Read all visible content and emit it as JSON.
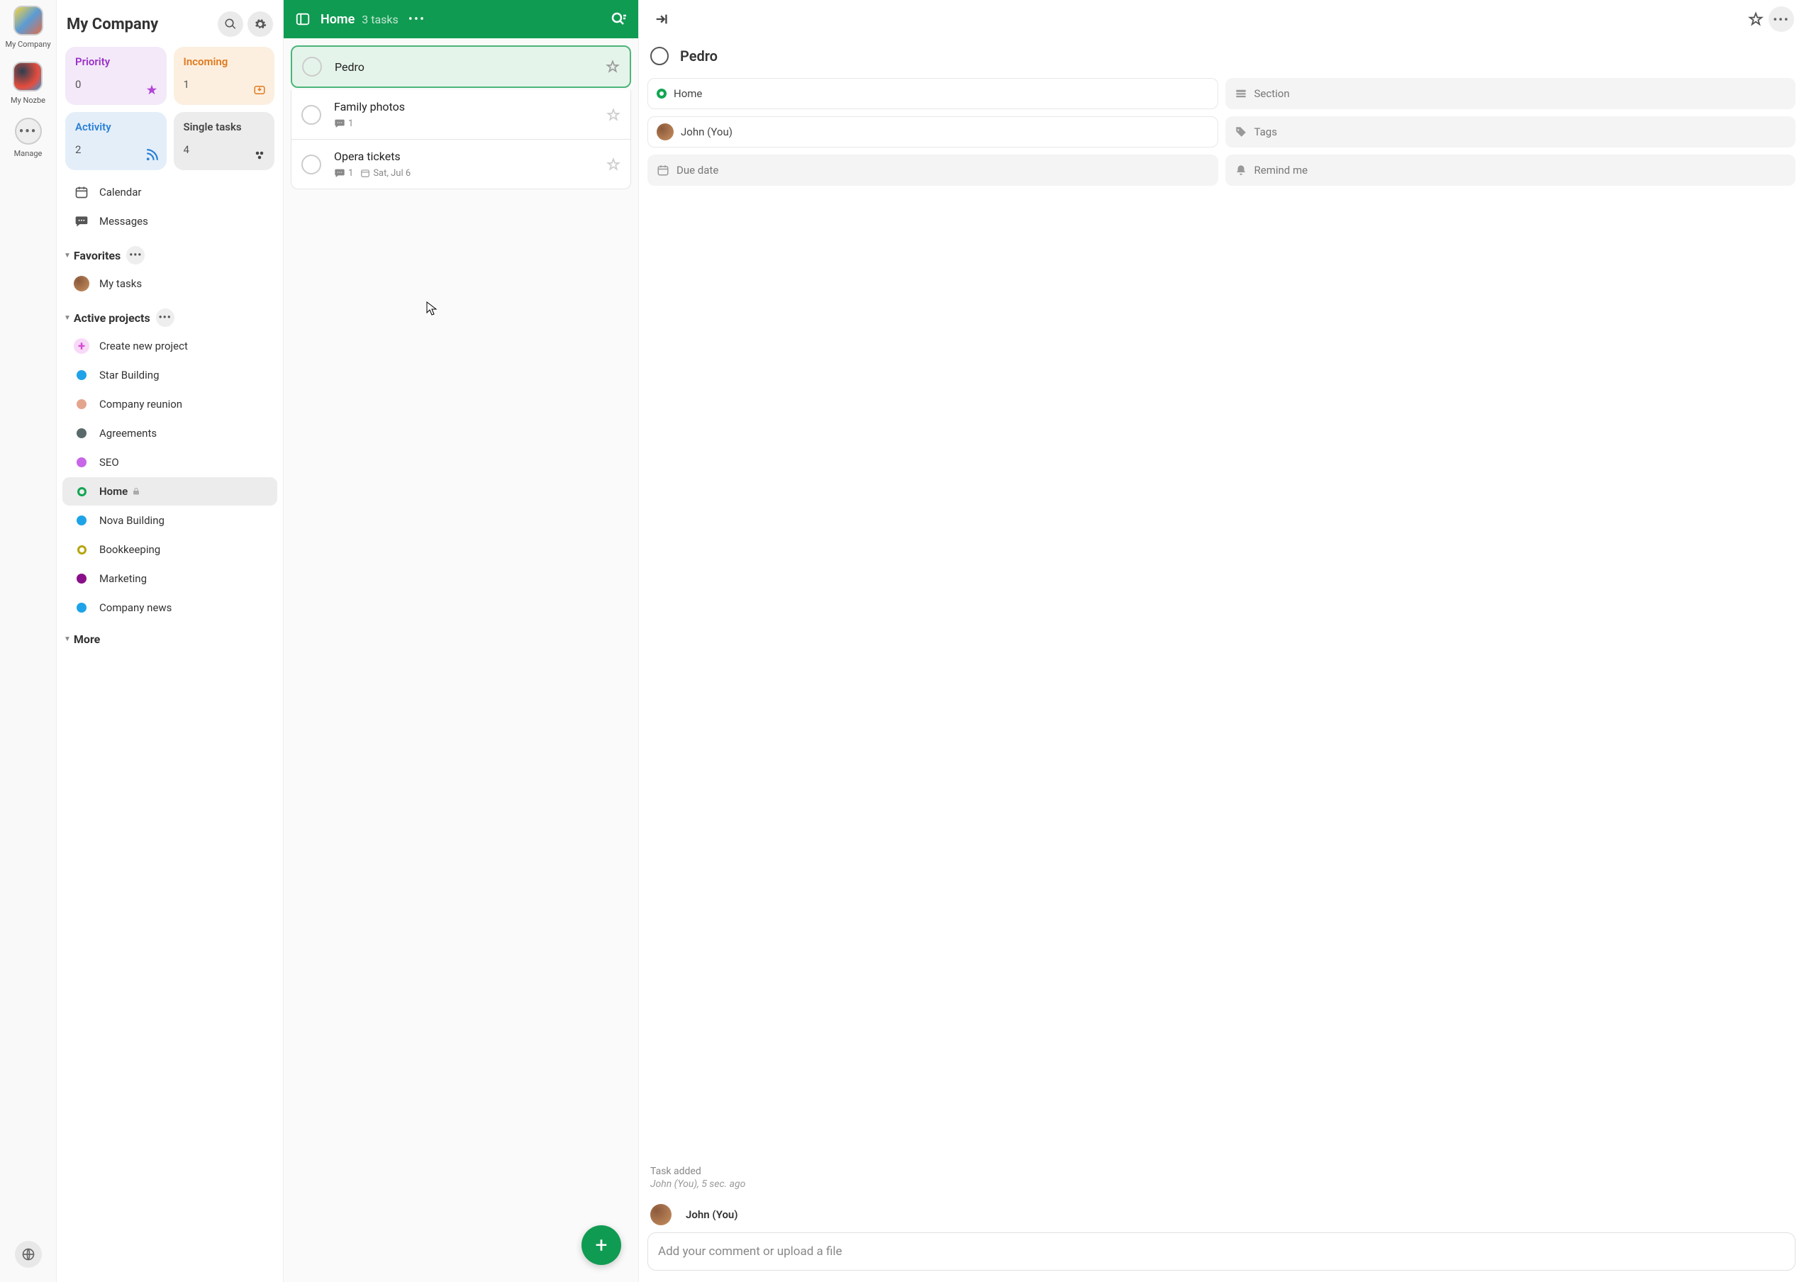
{
  "rail": {
    "company": "My Company",
    "personal": "My Nozbe",
    "manage": "Manage"
  },
  "sidebar": {
    "title": "My Company",
    "cards": {
      "priority": {
        "label": "Priority",
        "count": "0"
      },
      "incoming": {
        "label": "Incoming",
        "count": "1"
      },
      "activity": {
        "label": "Activity",
        "count": "2"
      },
      "single": {
        "label": "Single tasks",
        "count": "4"
      }
    },
    "calendar": "Calendar",
    "messages": "Messages",
    "favorites_header": "Favorites",
    "my_tasks": "My tasks",
    "active_header": "Active projects",
    "create_project": "Create new project",
    "projects": [
      {
        "label": "Star Building",
        "color": "#1fa3e8"
      },
      {
        "label": "Company reunion",
        "color": "#e4a58f"
      },
      {
        "label": "Agreements",
        "color": "#5a6a6a"
      },
      {
        "label": "SEO",
        "color": "#c866e8"
      },
      {
        "label": "Home",
        "color": "#12a653",
        "active": true,
        "locked": true,
        "ring": true
      },
      {
        "label": "Nova Building",
        "color": "#1fa3e8"
      },
      {
        "label": "Bookkeeping",
        "color": "#b5a50f",
        "ring": true
      },
      {
        "label": "Marketing",
        "color": "#8a0f8a"
      },
      {
        "label": "Company news",
        "color": "#1fa3e8"
      }
    ],
    "more_header": "More"
  },
  "main": {
    "title": "Home",
    "task_count": "3 tasks",
    "tasks": [
      {
        "title": "Pedro",
        "selected": true
      },
      {
        "title": "Family photos",
        "comments": "1"
      },
      {
        "title": "Opera tickets",
        "comments": "1",
        "date": "Sat, Jul 6"
      }
    ]
  },
  "details": {
    "title": "Pedro",
    "props": {
      "project": "Home",
      "section": "Section",
      "assignee": "John (You)",
      "tags": "Tags",
      "due": "Due date",
      "remind": "Remind me"
    },
    "activity": {
      "label": "Task added",
      "meta": "John (You), 5 sec. ago"
    },
    "commenter": "John (You)",
    "comment_placeholder": "Add your comment or upload a file"
  }
}
